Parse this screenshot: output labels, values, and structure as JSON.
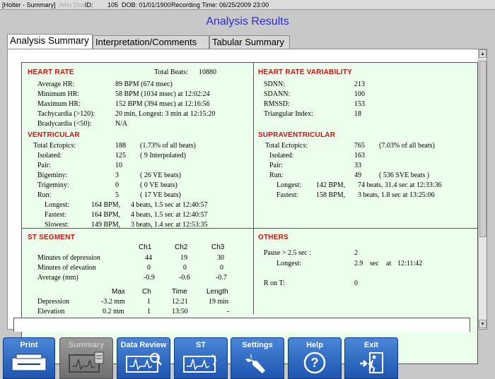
{
  "window": {
    "title": "[Holter - Summary]",
    "id_label": "ID:",
    "id_value": "105",
    "dob": "DOB: 01/01/1900",
    "recording_time": "Recording Time: 06/25/2009 23:00"
  },
  "heading": "Analysis Results",
  "tabs": [
    "Analysis Summary",
    "Interpretation/Comments",
    "Tabular Summary"
  ],
  "heart_rate": {
    "title": "HEART RATE",
    "total_beats_label": "Total Beats:",
    "total_beats": "10880",
    "rows": [
      {
        "label": "Average HR:",
        "value": "89 BPM (674 msec)"
      },
      {
        "label": "Minimum HR:",
        "value": "58 BPM (1034 msec) at 12:02:24"
      },
      {
        "label": "Maximum HR:",
        "value": "152 BPM (394 msec) at 12:16:56"
      },
      {
        "label": "Tachycardia (>120):",
        "value": "20 min, Longest: 3 min at 12:15:20"
      },
      {
        "label": "Bradycardia (<50):",
        "value": "N/A"
      }
    ]
  },
  "ventricular": {
    "title": "VENTRICULAR",
    "rows": [
      {
        "label": "Total Ectopics:",
        "value": "188",
        "note": "(1.73% of all beats)"
      },
      {
        "label": "Isolated:",
        "value": "125",
        "note": "( 9 Interpolated)"
      },
      {
        "label": "Pair:",
        "value": "10",
        "note": ""
      },
      {
        "label": "Bigeminy:",
        "value": "3",
        "note": "( 26 VE beats)"
      },
      {
        "label": "Trigeminy:",
        "value": "0",
        "note": "( 0 VE beats)"
      },
      {
        "label": "Run:",
        "value": "5",
        "note": "( 17 VE beats)"
      }
    ],
    "runs": [
      {
        "label": "Longest:",
        "bpm": "164 BPM,",
        "detail": "4 beats, 1.5 sec at 12:40:57"
      },
      {
        "label": "Fastest:",
        "bpm": "164 BPM,",
        "detail": "4 beats, 1.5 sec at 12:40:57"
      },
      {
        "label": "Slowest:",
        "bpm": "149 BPM,",
        "detail": "3 beats, 1.4 sec at 12:53:35"
      }
    ]
  },
  "hrv": {
    "title": "HEART RATE VARIABILITY",
    "rows": [
      {
        "label": "SDNN:",
        "value": "213"
      },
      {
        "label": "SDANN:",
        "value": "100"
      },
      {
        "label": "RMSSD:",
        "value": "153"
      },
      {
        "label": "Triangular Index:",
        "value": "18"
      }
    ]
  },
  "supraventricular": {
    "title": "SUPRAVENTRICULAR",
    "rows": [
      {
        "label": "Total Ectopics:",
        "value": "765",
        "note": "(7.03% of all beats)"
      },
      {
        "label": "Isolated:",
        "value": "163",
        "note": ""
      },
      {
        "label": "Pair:",
        "value": "33",
        "note": ""
      },
      {
        "label": "Run:",
        "value": "49",
        "note": "( 536 SVE beats )"
      }
    ],
    "runs": [
      {
        "label": "Longest:",
        "bpm": "142 BPM,",
        "detail": "74 beats, 31.4 sec at 12:33:36"
      },
      {
        "label": "Fastest:",
        "bpm": "158 BPM,",
        "detail": "3 beats, 1.8 sec at 13:25:06"
      }
    ]
  },
  "st_segment": {
    "title": "ST SEGMENT",
    "channels": [
      "Ch1",
      "Ch2",
      "Ch3"
    ],
    "rows": [
      {
        "label": "Minutes of depression",
        "values": [
          "44",
          "19",
          "30"
        ]
      },
      {
        "label": "Minutes of elevation",
        "values": [
          "0",
          "0",
          "0"
        ]
      },
      {
        "label": "Average (mm)",
        "values": [
          "-0.9",
          "-0.6",
          "-0.7"
        ]
      }
    ],
    "detail_headers": [
      "Max",
      "Ch",
      "Time",
      "Length"
    ],
    "details": [
      {
        "label": "Depression",
        "max": "-3.2 mm",
        "ch": "1",
        "time": "12:21",
        "length": "19 min"
      },
      {
        "label": "Elevation",
        "max": "0.2 mm",
        "ch": "1",
        "time": "13:50",
        "length": "-"
      }
    ]
  },
  "others": {
    "title": "OTHERS",
    "pause_label": "Pause > 2.5 sec :",
    "pause_value": "2",
    "longest_label": "Longest:",
    "longest_sec": "2.9",
    "longest_unit": "sec",
    "longest_at": "at",
    "longest_time": "12:11:42",
    "ron_label": "R on T:",
    "ron_value": "0"
  },
  "toolbar": {
    "buttons": [
      {
        "label": "Print",
        "icon": "printer-icon"
      },
      {
        "label": "Summary",
        "icon": "summary-icon"
      },
      {
        "label": "Data Review",
        "icon": "data-review-icon"
      },
      {
        "label": "ST",
        "icon": "st-icon"
      },
      {
        "label": "Settings",
        "icon": "wrench-icon"
      },
      {
        "label": "Help",
        "icon": "help-icon"
      },
      {
        "label": "Exit",
        "icon": "exit-icon"
      }
    ]
  },
  "colors": {
    "heading": "#2c2cd0",
    "section_title": "#d01010",
    "report_bg": "#ecffec",
    "button_blue": "#2a66c0"
  }
}
